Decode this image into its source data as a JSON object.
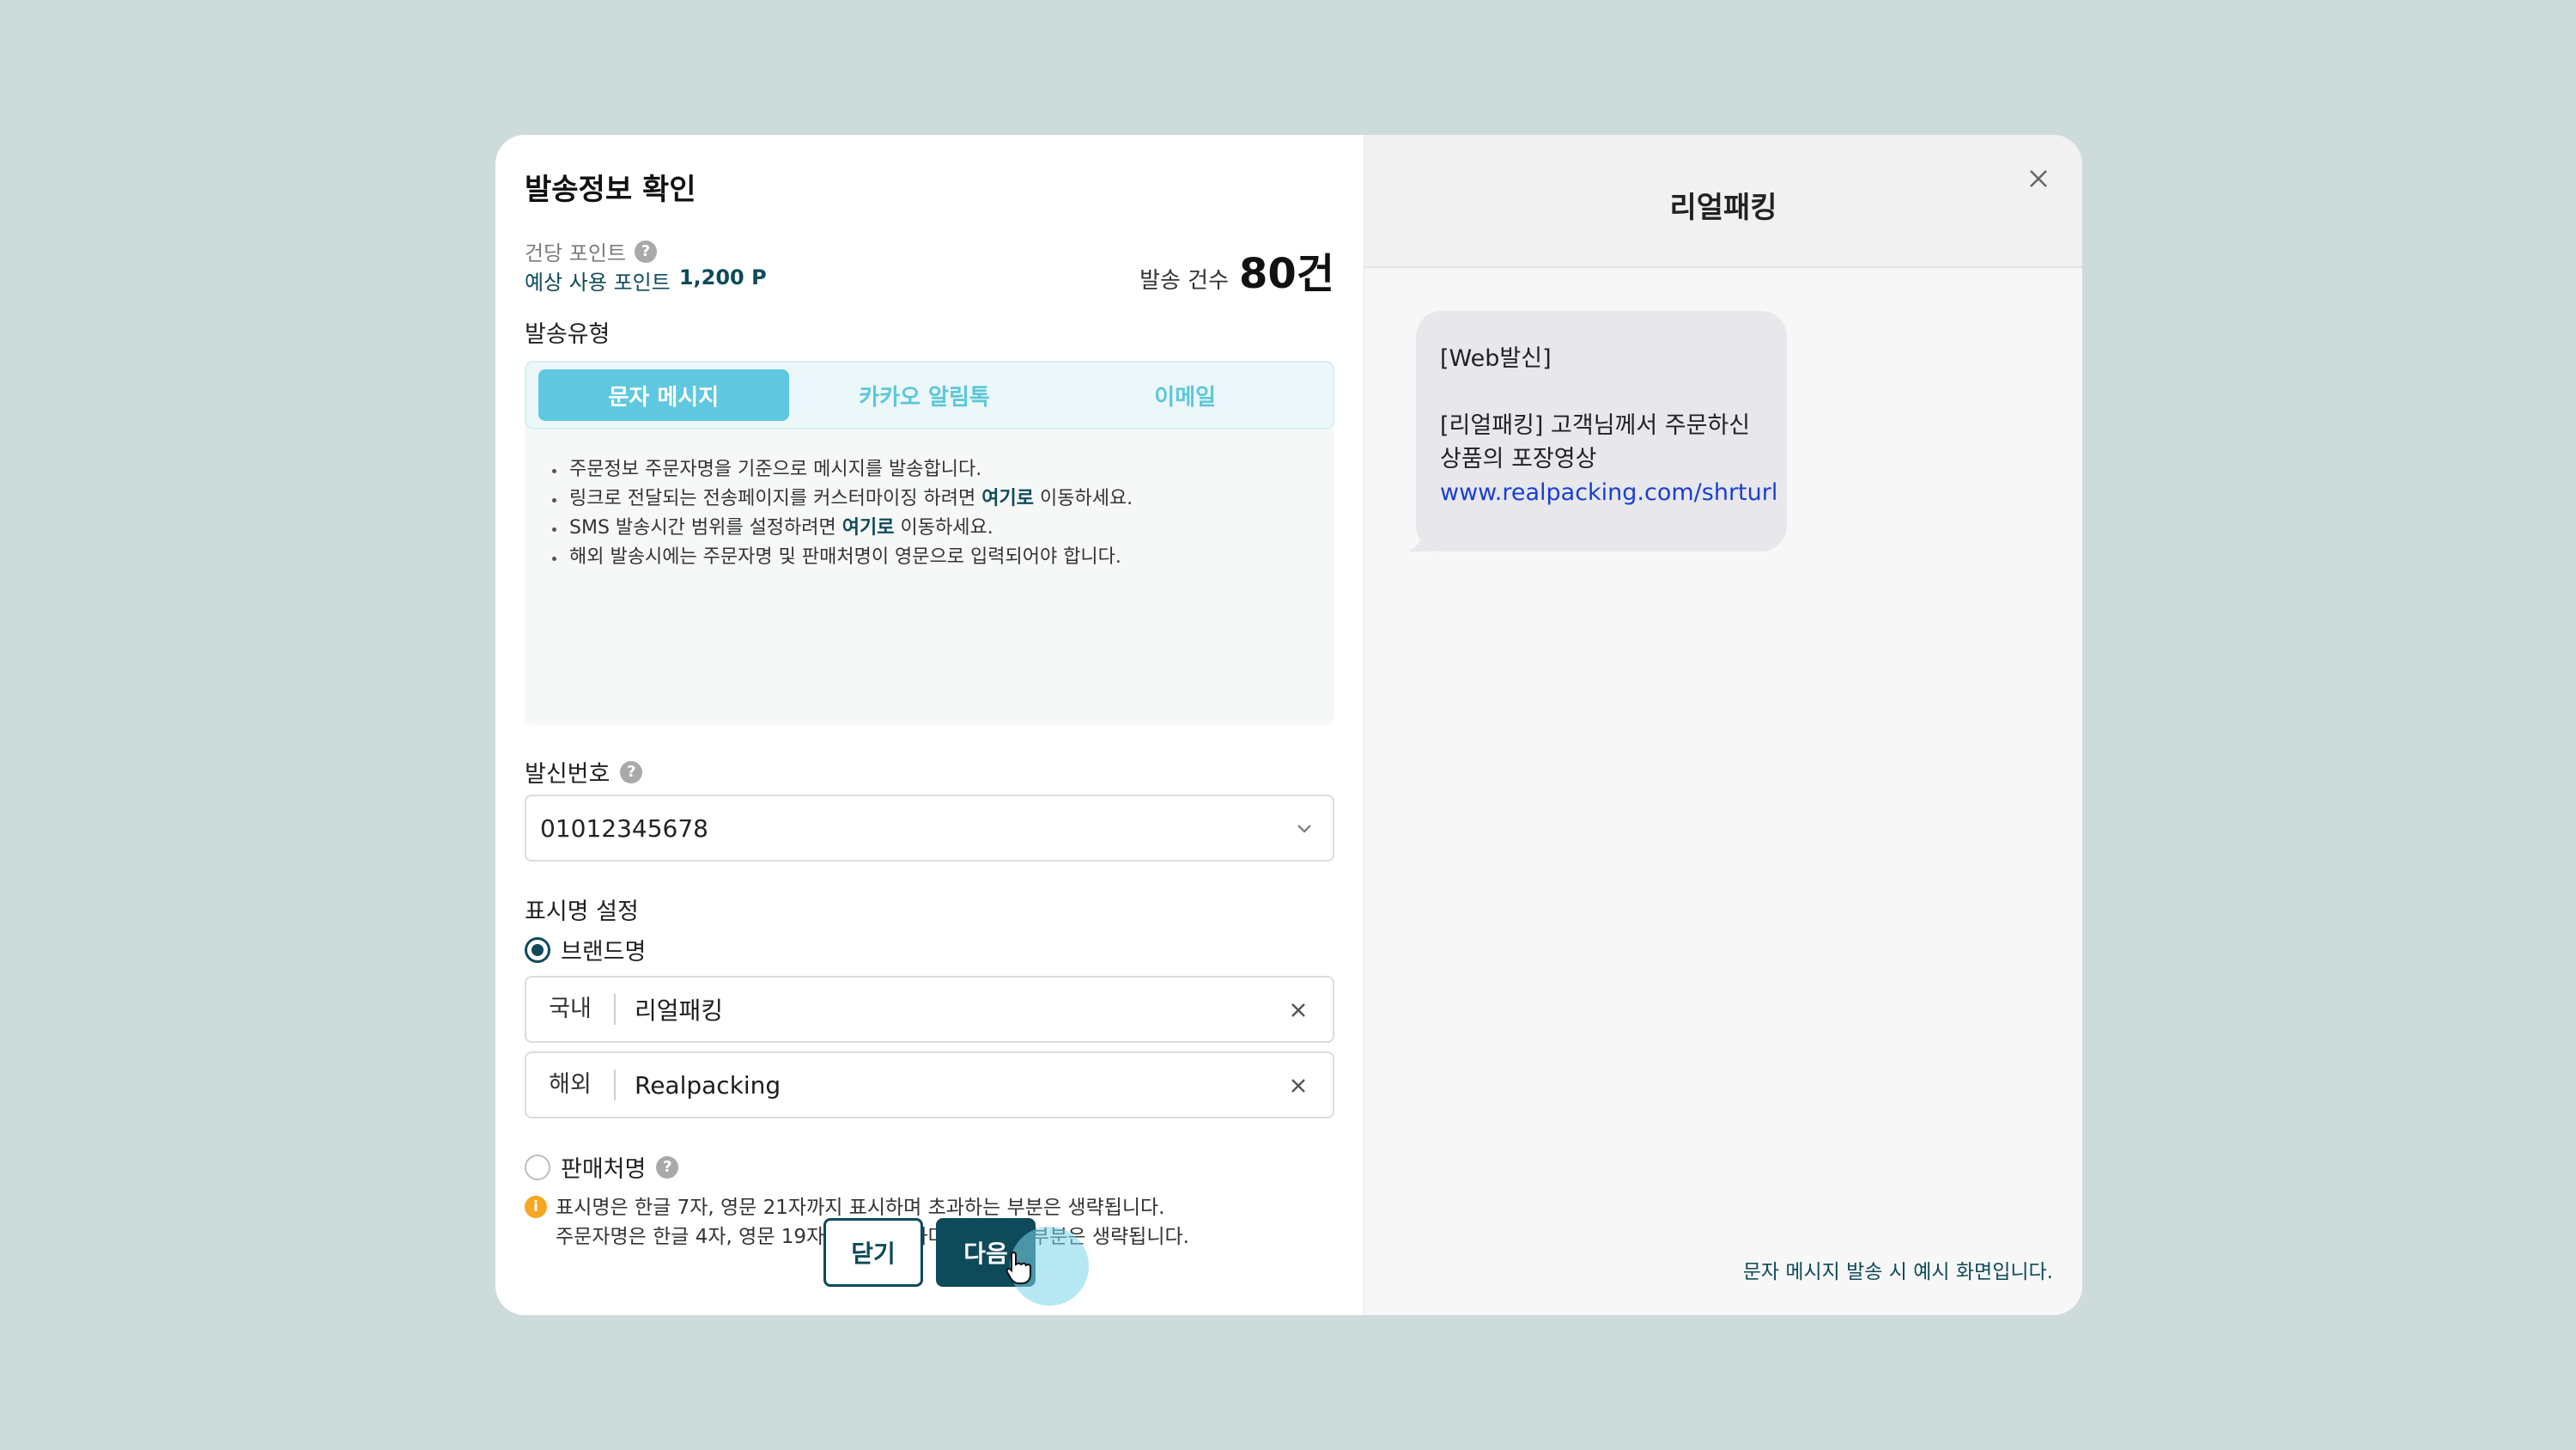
{
  "modal": {
    "title": "발송정보 확인",
    "points_label": "건당 포인트",
    "points_est_label": "예상 사용 포인트",
    "points_est_value": "1,200 P",
    "count_label": "발송 건수",
    "count_value": "80건",
    "help_glyph": "?"
  },
  "send_type": {
    "label": "발송유형",
    "tabs": [
      {
        "label": "문자 메시지",
        "active": true
      },
      {
        "label": "카카오 알림톡",
        "active": false
      },
      {
        "label": "이메일",
        "active": false
      }
    ],
    "bullets": [
      {
        "pre": "주문정보 주문자명을 기준으로 메시지를 발송합니다.",
        "link": "",
        "post": ""
      },
      {
        "pre": "링크로 전달되는 전송페이지를 커스터마이징 하려면 ",
        "link": "여기로",
        "post": " 이동하세요."
      },
      {
        "pre": "SMS 발송시간 범위를 설정하려면 ",
        "link": "여기로",
        "post": " 이동하세요."
      },
      {
        "pre": "해외 발송시에는 주문자명 및 판매처명이 영문으로 입력되어야 합니다.",
        "link": "",
        "post": ""
      }
    ]
  },
  "sender": {
    "label": "발신번호",
    "value": "01012345678"
  },
  "display_name": {
    "label": "표시명 설정",
    "brand_label": "브랜드명",
    "domestic_prefix": "국내",
    "domestic_value": "리얼패킹",
    "overseas_prefix": "해외",
    "overseas_value": "Realpacking",
    "seller_label": "판매처명",
    "notice_glyph": "i",
    "notice_line1": "표시명은 한글 7자, 영문 21자까지 표시하며 초과하는 부분은 생략됩니다.",
    "notice_line2": "주문자명은 한글 4자, 영문 19자 까지 표시하며 초과하는 부분은 생략됩니다."
  },
  "buttons": {
    "close": "닫기",
    "next": "다음"
  },
  "preview": {
    "brand": "리얼패킹",
    "msg_line1": "[Web발신]",
    "msg_line2": "[리얼패킹] 고객님께서 주문하신",
    "msg_line3": "상품의 포장영상",
    "msg_link": "www.realpacking.com/shrturl",
    "note": "문자 메시지 발송 시 예시 화면입니다."
  },
  "colors": {
    "backdrop": "#cddbdb",
    "primary": "#0e4a5a",
    "accent": "#5fc7e0",
    "link": "#1a3fd1",
    "warning": "#f5a623"
  }
}
